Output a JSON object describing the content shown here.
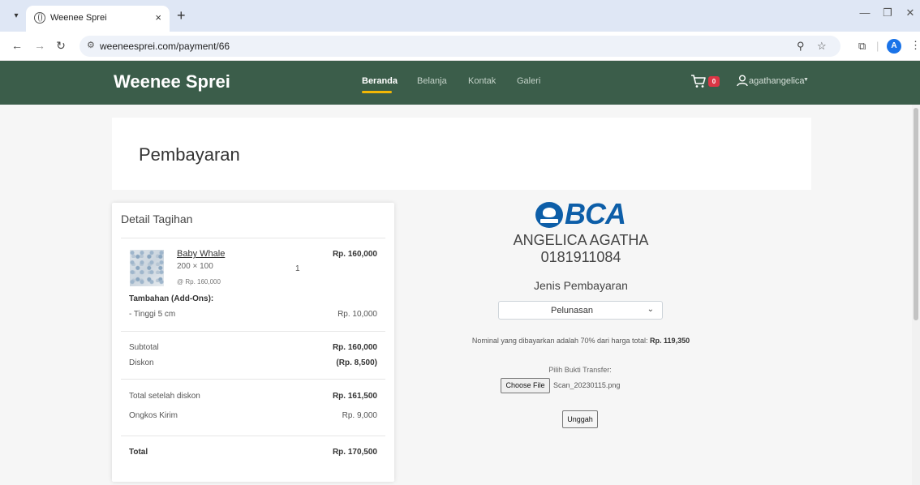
{
  "browser": {
    "tab_title": "Weenee Sprei",
    "tab_close": "×",
    "new_tab": "+",
    "url": "weeneesprei.com/payment/66",
    "profile_initial": "A"
  },
  "navbar": {
    "brand": "Weenee Sprei",
    "links": [
      "Beranda",
      "Belanja",
      "Kontak",
      "Galeri"
    ],
    "active_link": "Beranda",
    "cart_count": "0",
    "username": "agathangelica"
  },
  "page": {
    "title": "Pembayaran"
  },
  "invoice": {
    "title": "Detail Tagihan",
    "item": {
      "name": "Baby Whale",
      "size": "200 × 100",
      "unit_price": "@ Rp. 160,000",
      "qty": "1",
      "price": "Rp. 160,000"
    },
    "addons_title": "Tambahan (Add-Ons):",
    "addon": {
      "name": "- Tinggi 5 cm",
      "price": "Rp. 10,000"
    },
    "subtotal_label": "Subtotal",
    "subtotal": "Rp. 160,000",
    "discount_label": "Diskon",
    "discount": "(Rp. 8,500)",
    "after_discount_label": "Total setelah diskon",
    "after_discount": "Rp. 161,500",
    "shipping_label": "Ongkos Kirim",
    "shipping": "Rp. 9,000",
    "total_label": "Total",
    "total": "Rp. 170,500"
  },
  "payment": {
    "bank_logo_text": "BCA",
    "account_name": "ANGELICA AGATHA",
    "account_number": "0181911084",
    "type_label": "Jenis Pembayaran",
    "type_selected": "Pelunasan",
    "nominal_text": "Nominal yang dibayarkan adalah 70% dari harga total:",
    "nominal_amount": "Rp. 119,350",
    "proof_label": "Pilih Bukti Transfer:",
    "choose_file": "Choose File",
    "file_name": "Scan_20230115.png",
    "upload": "Unggah"
  },
  "colors": {
    "navbar_bg": "#3b5d4a",
    "active_underline": "#f2b705",
    "badge": "#dc3545",
    "bca_blue": "#0d5ea8"
  }
}
